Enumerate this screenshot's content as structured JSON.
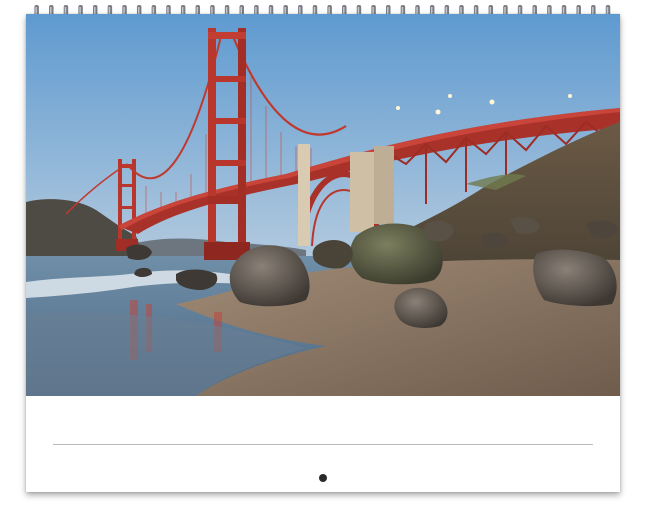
{
  "calendar": {
    "photo_subject": "golden-gate-bridge",
    "colors": {
      "sky_top": "#6fa9d8",
      "sky_bottom": "#c9d8e4",
      "bridge_red": "#b8362c",
      "sand": "#8f7a66",
      "water": "#5f7f9c",
      "binding_wire": "#7a7f86"
    },
    "binding_ring_count": 40
  }
}
